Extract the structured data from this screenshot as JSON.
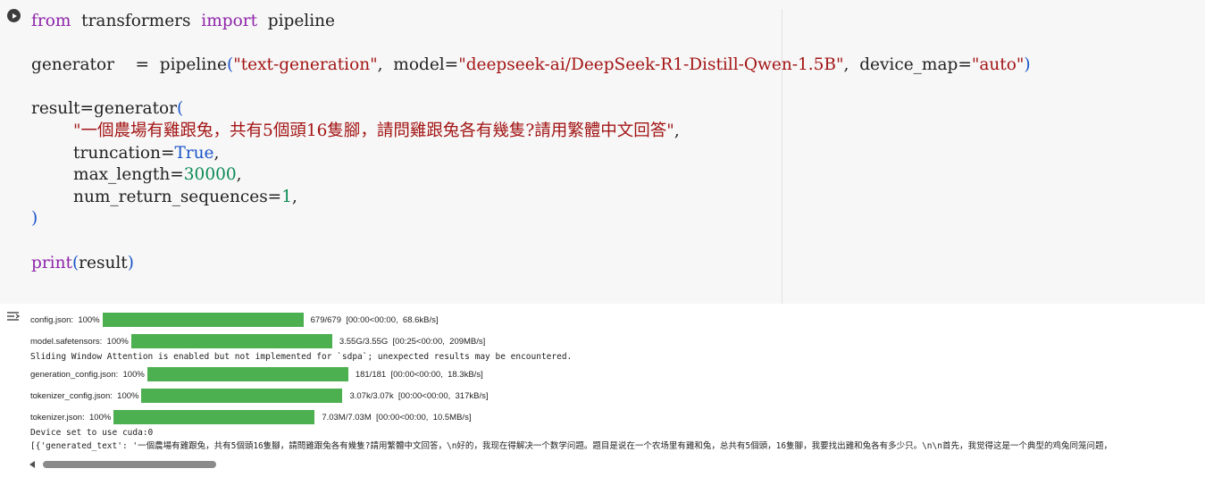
{
  "code": {
    "lines": [
      [
        {
          "t": "from",
          "c": "kw"
        },
        {
          "t": "  transformers  ",
          "c": ""
        },
        {
          "t": "import",
          "c": "kw"
        },
        {
          "t": "  pipeline",
          "c": ""
        }
      ],
      [],
      [
        {
          "t": "generator    =  pipeline",
          "c": ""
        },
        {
          "t": "(",
          "c": "par"
        },
        {
          "t": "\"text-generation\"",
          "c": "str"
        },
        {
          "t": ",  model=",
          "c": ""
        },
        {
          "t": "\"deepseek-ai/DeepSeek-R1-Distill-Qwen-1.5B\"",
          "c": "str"
        },
        {
          "t": ",  device_map=",
          "c": ""
        },
        {
          "t": "\"auto\"",
          "c": "str"
        },
        {
          "t": ")",
          "c": "par"
        }
      ],
      [],
      [
        {
          "t": "result=generator",
          "c": ""
        },
        {
          "t": "(",
          "c": "par"
        }
      ],
      [
        {
          "t": "        ",
          "c": ""
        },
        {
          "t": "\"一個農場有雞跟兔，共有5個頭16隻腳，請問雞跟兔各有幾隻?請用繁體中文回答\"",
          "c": "str"
        },
        {
          "t": ",",
          "c": ""
        }
      ],
      [
        {
          "t": "        truncation=",
          "c": ""
        },
        {
          "t": "True",
          "c": "bool"
        },
        {
          "t": ",",
          "c": ""
        }
      ],
      [
        {
          "t": "        max_length=",
          "c": ""
        },
        {
          "t": "30000",
          "c": "num"
        },
        {
          "t": ",",
          "c": ""
        }
      ],
      [
        {
          "t": "        num_return_sequences=",
          "c": ""
        },
        {
          "t": "1",
          "c": "num"
        },
        {
          "t": ",",
          "c": ""
        }
      ],
      [
        {
          "t": ")",
          "c": "par"
        }
      ],
      [],
      [
        {
          "t": "print",
          "c": "kw"
        },
        {
          "t": "(",
          "c": "par"
        },
        {
          "t": "result",
          "c": ""
        },
        {
          "t": ")",
          "c": "par"
        }
      ]
    ]
  },
  "output": {
    "progress": [
      {
        "label": "config.json:  100%",
        "status": "679/679  [00:00<00:00,  68.6kB/s]",
        "fraction": 1.0
      },
      {
        "label": "model.safetensors:  100%",
        "status": "3.55G/3.55G  [00:25<00:00,  209MB/s]",
        "fraction": 1.0
      },
      {
        "label": "generation_config.json:  100%",
        "status": "181/181  [00:00<00:00,  18.3kB/s]",
        "fraction": 1.0
      },
      {
        "label": "tokenizer_config.json:  100%",
        "status": "3.07k/3.07k  [00:00<00:00,  317kB/s]",
        "fraction": 1.0
      },
      {
        "label": "tokenizer.json:  100%",
        "status": "7.03M/7.03M  [00:00<00:00,  10.5MB/s]",
        "fraction": 1.0
      }
    ],
    "warning": "Sliding Window Attention is enabled but not implemented for `sdpa`; unexpected results may be encountered.",
    "device": "Device set to use cuda:0",
    "result": "[{'generated_text': '一個農場有雞跟兔，共有5個頭16隻腳，請問雞跟兔各有幾隻?請用繁體中文回答，\\n好的，我现在得解决一个数学问题。题目是说在一个农场里有雞和兔，总共有5個頭，16隻腳，我要找出雞和兔各有多少只。\\n\\n首先，我觉得这是一个典型的鸡兔同笼问题，"
  },
  "icons": {
    "run": "play-circle-icon",
    "output_toggle": "output-options-icon"
  },
  "colors": {
    "progress_bar": "#4caf50",
    "keyword": "#8e24aa",
    "string": "#a31515",
    "number": "#0b8a55"
  }
}
